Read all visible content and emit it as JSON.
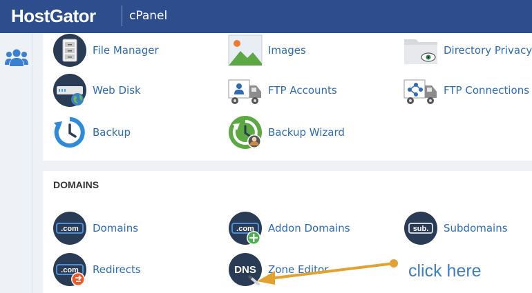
{
  "header": {
    "brand": "HostGator",
    "product": "cPanel"
  },
  "files": {
    "items": [
      {
        "label": "File Manager",
        "icon": "file-cabinet-icon"
      },
      {
        "label": "Images",
        "icon": "image-icon"
      },
      {
        "label": "Directory Privacy",
        "icon": "folder-eye-icon"
      },
      {
        "label": "Web Disk",
        "icon": "hard-drive-globe-icon"
      },
      {
        "label": "FTP Accounts",
        "icon": "truck-user-icon"
      },
      {
        "label": "FTP Connections",
        "icon": "truck-network-icon"
      },
      {
        "label": "Backup",
        "icon": "backup-icon"
      },
      {
        "label": "Backup Wizard",
        "icon": "backup-wizard-icon"
      }
    ]
  },
  "domains": {
    "title": "DOMAINS",
    "com_text": ".com",
    "sub_text": "sub.",
    "dns_text": "DNS",
    "items": [
      {
        "label": "Domains",
        "icon": "dotcom-icon"
      },
      {
        "label": "Addon Domains",
        "icon": "dotcom-plus-icon"
      },
      {
        "label": "Subdomains",
        "icon": "sub-icon"
      },
      {
        "label": "Redirects",
        "icon": "dotcom-redirect-icon"
      },
      {
        "label": "Zone Editor",
        "icon": "dns-icon"
      }
    ]
  },
  "annotation": {
    "text": "click here",
    "color": "#e2a232"
  },
  "colors": {
    "header": "#2e4d8c",
    "link": "#2f6bb3",
    "icon_dark": "#2a3b55"
  }
}
